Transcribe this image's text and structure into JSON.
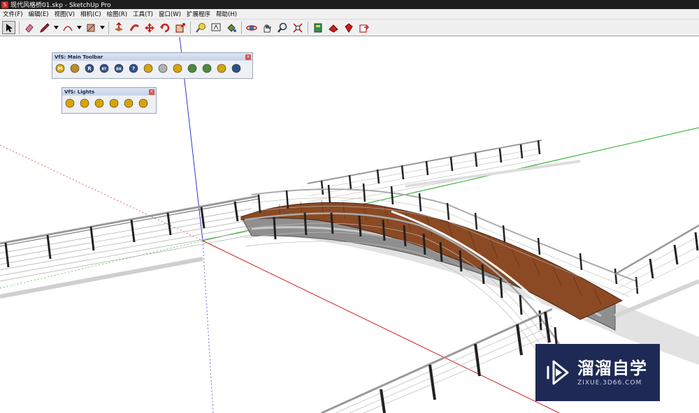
{
  "window": {
    "title": "现代风格桥01.skp - SketchUp Pro",
    "app_icon": "sketchup-icon"
  },
  "menu": [
    "文件(F)",
    "编辑(E)",
    "视图(V)",
    "相机(C)",
    "绘图(R)",
    "工具(T)",
    "窗口(W)",
    "扩展程序",
    "帮助(H)"
  ],
  "toolbar": {
    "tools": [
      "select-icon",
      "eraser-icon",
      "pencil-icon",
      "arc-icon",
      "rectangle-icon",
      "push-pull-icon",
      "follow-me-icon",
      "move-icon",
      "rotate-icon",
      "scale-icon",
      "tape-measure-icon",
      "text-icon",
      "paint-bucket-icon",
      "orbit-icon",
      "pan-icon",
      "zoom-icon",
      "zoom-extents-icon",
      "warehouse-icon",
      "extension-warehouse-icon",
      "ruby-icon",
      "send-to-layout-icon"
    ]
  },
  "vfs_main": {
    "title": "VfS: Main Toolbar",
    "buttons": [
      {
        "icon": "render-m-icon",
        "label": "M",
        "color": "#d9a400"
      },
      {
        "icon": "material-icon",
        "label": "",
        "color": "#c08a20"
      },
      {
        "icon": "render-r-icon",
        "label": "R",
        "color": "#2f4f87"
      },
      {
        "icon": "render-rt-icon",
        "label": "RT",
        "color": "#2f4f87"
      },
      {
        "icon": "render-br-icon",
        "label": "BR",
        "color": "#2f4f87"
      },
      {
        "icon": "help-icon",
        "label": "?",
        "color": "#2f4f87"
      },
      {
        "icon": "tag-icon",
        "label": "",
        "color": "#d9a400"
      },
      {
        "icon": "sphere-icon",
        "label": "",
        "color": "#b0b0b0"
      },
      {
        "icon": "sun-icon",
        "label": "",
        "color": "#d9a400"
      },
      {
        "icon": "environment-icon",
        "label": "",
        "color": "#4a8a3a"
      },
      {
        "icon": "environment-light-icon",
        "label": "",
        "color": "#4a8a3a"
      },
      {
        "icon": "target-icon",
        "label": "",
        "color": "#d9a400"
      },
      {
        "icon": "frame-buffer-icon",
        "label": "",
        "color": "#2f4f87"
      }
    ]
  },
  "vfs_lights": {
    "title": "VfS: Lights",
    "buttons": [
      {
        "icon": "omni-light-icon",
        "color": "#d9a400"
      },
      {
        "icon": "rectangle-light-icon",
        "color": "#d9a400"
      },
      {
        "icon": "spot-light-icon",
        "color": "#d9a400"
      },
      {
        "icon": "dome-light-icon",
        "color": "#d9a400"
      },
      {
        "icon": "sphere-light-icon",
        "color": "#d9a400"
      },
      {
        "icon": "ies-light-icon",
        "color": "#d9a400"
      }
    ]
  },
  "watermark": {
    "brand": "溜溜自学",
    "url": "ZIXUE.3D66.COM"
  },
  "colors": {
    "deck": "#8b4a24",
    "axis_red": "#cc0000",
    "axis_green": "#00aa00",
    "axis_blue": "#0000cc"
  }
}
